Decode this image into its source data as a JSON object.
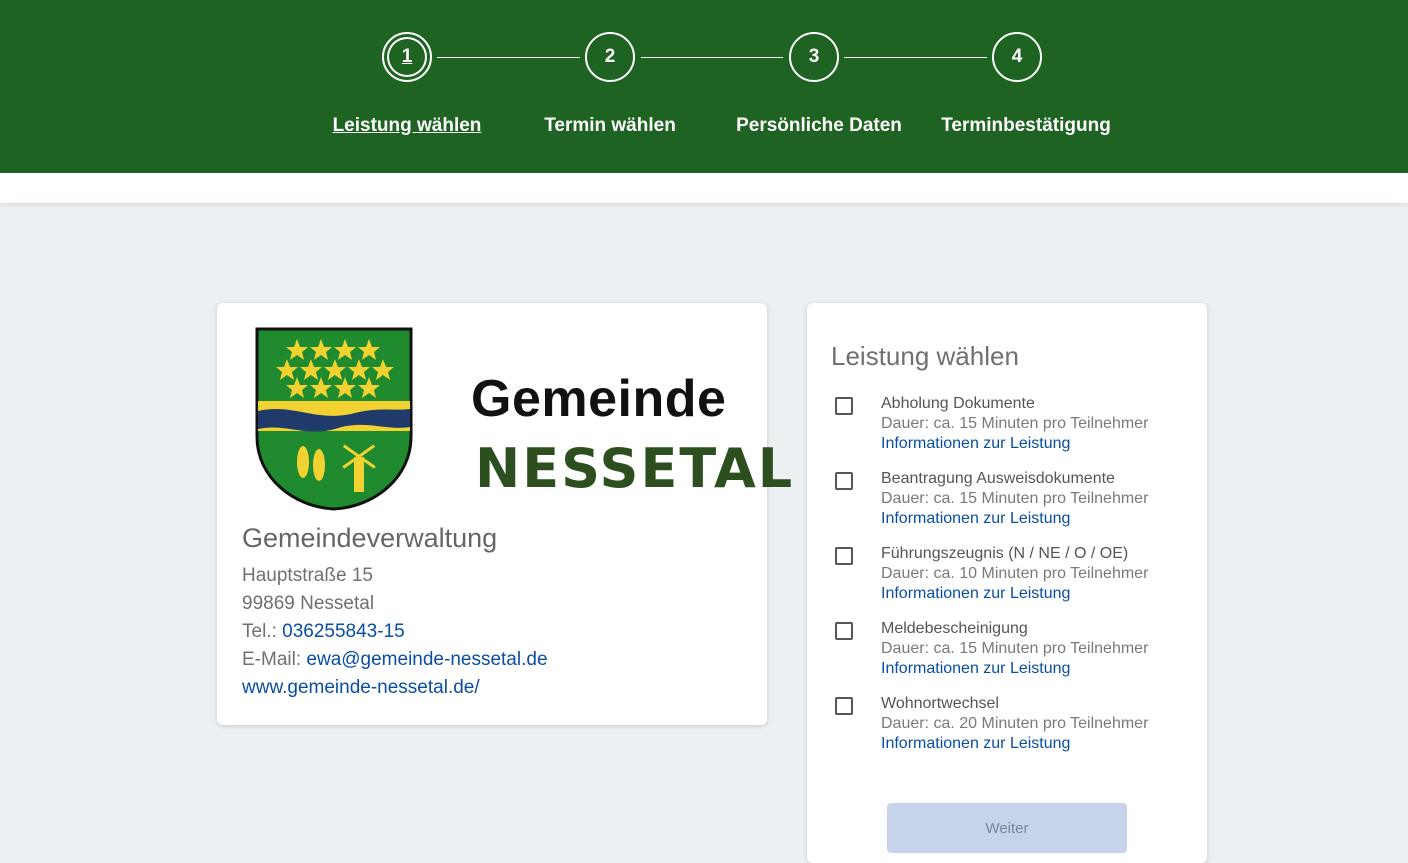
{
  "stepper": {
    "steps": [
      {
        "number": "1",
        "label": "Leistung wählen"
      },
      {
        "number": "2",
        "label": "Termin wählen"
      },
      {
        "number": "3",
        "label": "Persönliche Daten"
      },
      {
        "number": "4",
        "label": "Terminbestätigung"
      }
    ],
    "active_step": 1
  },
  "logo": {
    "line1": "Gemeinde",
    "line2": "NESSETAL"
  },
  "office": {
    "title": "Gemeindeverwaltung",
    "street": "Hauptstraße 15",
    "city": "99869 Nessetal",
    "phone_prefix": "Tel.:",
    "phone": "036255843-15",
    "email_prefix": "E-Mail:",
    "email": "ewa@gemeinde-nessetal.de",
    "website": "www.gemeinde-nessetal.de/"
  },
  "services_panel": {
    "title": "Leistung wählen",
    "info_link_label": "Informationen zur Leistung",
    "items": [
      {
        "name": "Abholung Dokumente",
        "duration": "Dauer: ca. 15 Minuten pro Teilnehmer"
      },
      {
        "name": "Beantragung Ausweisdokumente",
        "duration": "Dauer: ca. 15 Minuten pro Teilnehmer"
      },
      {
        "name": "Führungszeugnis (N / NE / O / OE)",
        "duration": "Dauer: ca. 10 Minuten pro Teilnehmer"
      },
      {
        "name": "Meldebescheinigung",
        "duration": "Dauer: ca. 15 Minuten pro Teilnehmer"
      },
      {
        "name": "Wohnortwechsel",
        "duration": "Dauer: ca. 20 Minuten pro Teilnehmer"
      }
    ],
    "next_label": "Weiter"
  },
  "colors": {
    "header_green": "#1e6321",
    "link_blue": "#0a4ea3",
    "disabled_button": "#c7d3ea",
    "page_background": "#edf0f2"
  }
}
